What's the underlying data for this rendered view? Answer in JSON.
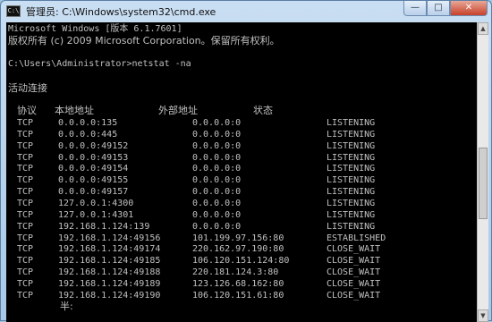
{
  "window": {
    "title": "管理员: C:\\Windows\\system32\\cmd.exe",
    "icon_label": "C:\\",
    "controls": {
      "minimize": "—",
      "maximize": "□",
      "close": "✕"
    }
  },
  "console": {
    "version_line": "Microsoft Windows [版本 6.1.7601]",
    "copyright_line": "版权所有 (c) 2009 Microsoft Corporation。保留所有权利。",
    "prompt_line": "C:\\Users\\Administrator>netstat -na",
    "section_title": "活动连接",
    "headers": [
      "协议",
      "本地地址",
      "外部地址",
      "状态"
    ],
    "rows": [
      {
        "proto": "TCP",
        "local": "0.0.0.0:135",
        "foreign": "0.0.0.0:0",
        "state": "LISTENING"
      },
      {
        "proto": "TCP",
        "local": "0.0.0.0:445",
        "foreign": "0.0.0.0:0",
        "state": "LISTENING"
      },
      {
        "proto": "TCP",
        "local": "0.0.0.0:49152",
        "foreign": "0.0.0.0:0",
        "state": "LISTENING"
      },
      {
        "proto": "TCP",
        "local": "0.0.0.0:49153",
        "foreign": "0.0.0.0:0",
        "state": "LISTENING"
      },
      {
        "proto": "TCP",
        "local": "0.0.0.0:49154",
        "foreign": "0.0.0.0:0",
        "state": "LISTENING"
      },
      {
        "proto": "TCP",
        "local": "0.0.0.0:49155",
        "foreign": "0.0.0.0:0",
        "state": "LISTENING"
      },
      {
        "proto": "TCP",
        "local": "0.0.0.0:49157",
        "foreign": "0.0.0.0:0",
        "state": "LISTENING"
      },
      {
        "proto": "TCP",
        "local": "127.0.0.1:4300",
        "foreign": "0.0.0.0:0",
        "state": "LISTENING"
      },
      {
        "proto": "TCP",
        "local": "127.0.0.1:4301",
        "foreign": "0.0.0.0:0",
        "state": "LISTENING"
      },
      {
        "proto": "TCP",
        "local": "192.168.1.124:139",
        "foreign": "0.0.0.0:0",
        "state": "LISTENING"
      },
      {
        "proto": "TCP",
        "local": "192.168.1.124:49156",
        "foreign": "101.199.97.156:80",
        "state": "ESTABLISHED"
      },
      {
        "proto": "TCP",
        "local": "192.168.1.124:49174",
        "foreign": "220.162.97.190:80",
        "state": "CLOSE_WAIT"
      },
      {
        "proto": "TCP",
        "local": "192.168.1.124:49185",
        "foreign": "106.120.151.124:80",
        "state": "CLOSE_WAIT"
      },
      {
        "proto": "TCP",
        "local": "192.168.1.124:49188",
        "foreign": "220.181.124.3:80",
        "state": "CLOSE_WAIT"
      },
      {
        "proto": "TCP",
        "local": "192.168.1.124:49189",
        "foreign": "123.126.68.162:80",
        "state": "CLOSE_WAIT"
      },
      {
        "proto": "TCP",
        "local": "192.168.1.124:49190",
        "foreign": "106.120.151.61:80",
        "state": "CLOSE_WAIT"
      }
    ],
    "ime_text": "半:"
  },
  "scrollbar": {
    "up": "▲",
    "down": "▼"
  }
}
